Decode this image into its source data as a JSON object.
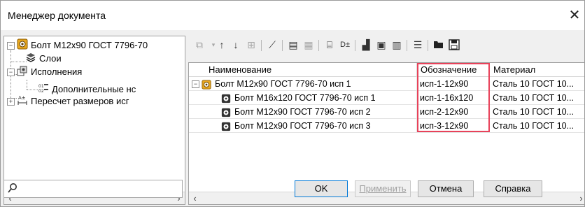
{
  "window": {
    "title": "Менеджер документа",
    "close_glyph": "✕"
  },
  "tree": {
    "root_label": "Болт М12х90 ГОСТ 7796-70",
    "items": [
      {
        "label": "Слои"
      },
      {
        "label": "Исполнения"
      },
      {
        "label": "Дополнительные нс"
      },
      {
        "label": "Пересчет размеров исг"
      }
    ],
    "expander_minus": "−",
    "expander_plus": "+"
  },
  "toolbar": {
    "icons": [
      "add-row-icon",
      "move-up-icon",
      "move-down-icon",
      "table-icon",
      "magic-wand-icon",
      "properties-icon",
      "columns-icon",
      "rename-icon",
      "dplus-icon",
      "paste-icon",
      "copy-icon",
      "group-icon",
      "list-icon",
      "open-folder-icon",
      "save-icon"
    ]
  },
  "grid": {
    "columns": [
      "Наименование",
      "Обозначение",
      "Материал"
    ],
    "rows": [
      {
        "name": "Болт М12х90 ГОСТ 7796-70 исп 1",
        "designation": "исп-1-12х90",
        "material": "Сталь 10  ГОСТ 10..."
      },
      {
        "name": "Болт М16х120 ГОСТ 7796-70 исп 1",
        "designation": "исп-1-16х120",
        "material": "Сталь 10  ГОСТ 10..."
      },
      {
        "name": "Болт М12х90 ГОСТ 7796-70 исп 2",
        "designation": "исп-2-12х90",
        "material": "Сталь 10  ГОСТ 10..."
      },
      {
        "name": "Болт М12х90 ГОСТ 7796-70 исп 3",
        "designation": "исп-3-12х90",
        "material": "Сталь 10  ГОСТ 10..."
      }
    ],
    "highlight_color": "#e8425a"
  },
  "bottom": {
    "search_value": "",
    "ok_label": "OK",
    "apply_label": "Применить",
    "cancel_label": "Отмена",
    "help_label": "Справка"
  },
  "colors": {
    "accent_blue": "#0078d7",
    "icon_orange": "#e0a020"
  }
}
